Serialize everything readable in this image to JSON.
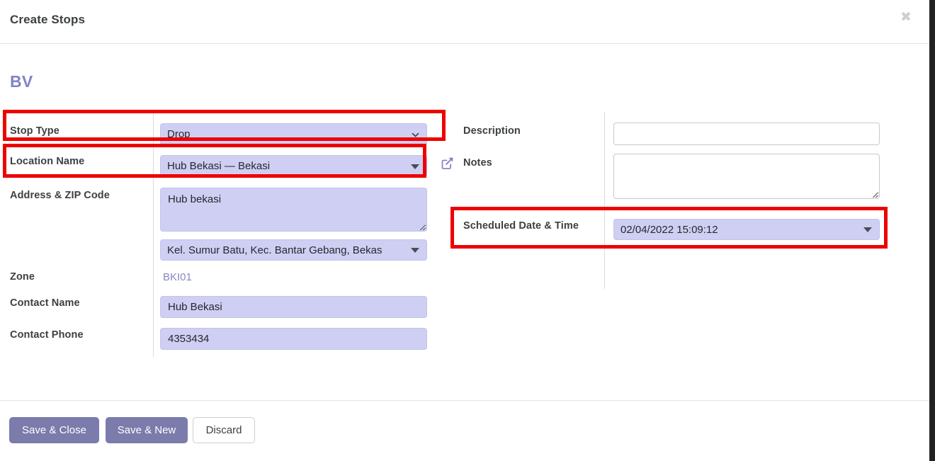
{
  "modal": {
    "title": "Create Stops",
    "close_icon": "close-icon",
    "section_title": "BV"
  },
  "left_column": {
    "stop_type": {
      "label": "Stop Type",
      "value": "Drop",
      "icon": "chevron-down-icon"
    },
    "location_name": {
      "label": "Location Name",
      "value": "Hub Bekasi — Bekasi",
      "icon": "triangle-down-icon"
    },
    "address_zip": {
      "label": "Address & ZIP Code",
      "value": "Hub bekasi",
      "placeholder": ""
    },
    "address_select": {
      "value": "Kel. Sumur Batu, Kec. Bantar Gebang, Bekas",
      "icon": "triangle-down-icon"
    },
    "zone": {
      "label": "Zone",
      "value": "BKI01"
    },
    "contact_name": {
      "label": "Contact Name",
      "value": "Hub Bekasi",
      "placeholder": ""
    },
    "contact_phone": {
      "label": "Contact Phone",
      "value": "4353434",
      "placeholder": ""
    }
  },
  "right_column": {
    "description": {
      "label": "Description",
      "value": "",
      "placeholder": ""
    },
    "notes": {
      "label": "Notes",
      "icon": "external-link-icon",
      "value": "",
      "placeholder": ""
    },
    "scheduled_datetime": {
      "label": "Scheduled Date & Time",
      "value": "02/04/2022 15:09:12",
      "icon": "triangle-down-icon"
    }
  },
  "footer": {
    "save_close_label": "Save & Close",
    "save_new_label": "Save & New",
    "discard_label": "Discard"
  },
  "colors": {
    "accent_purple": "#8282c8",
    "field_fill": "#cfcff4",
    "button_primary": "#7b7bac",
    "highlight_red": "#ee0000",
    "page_background": "#222222"
  }
}
